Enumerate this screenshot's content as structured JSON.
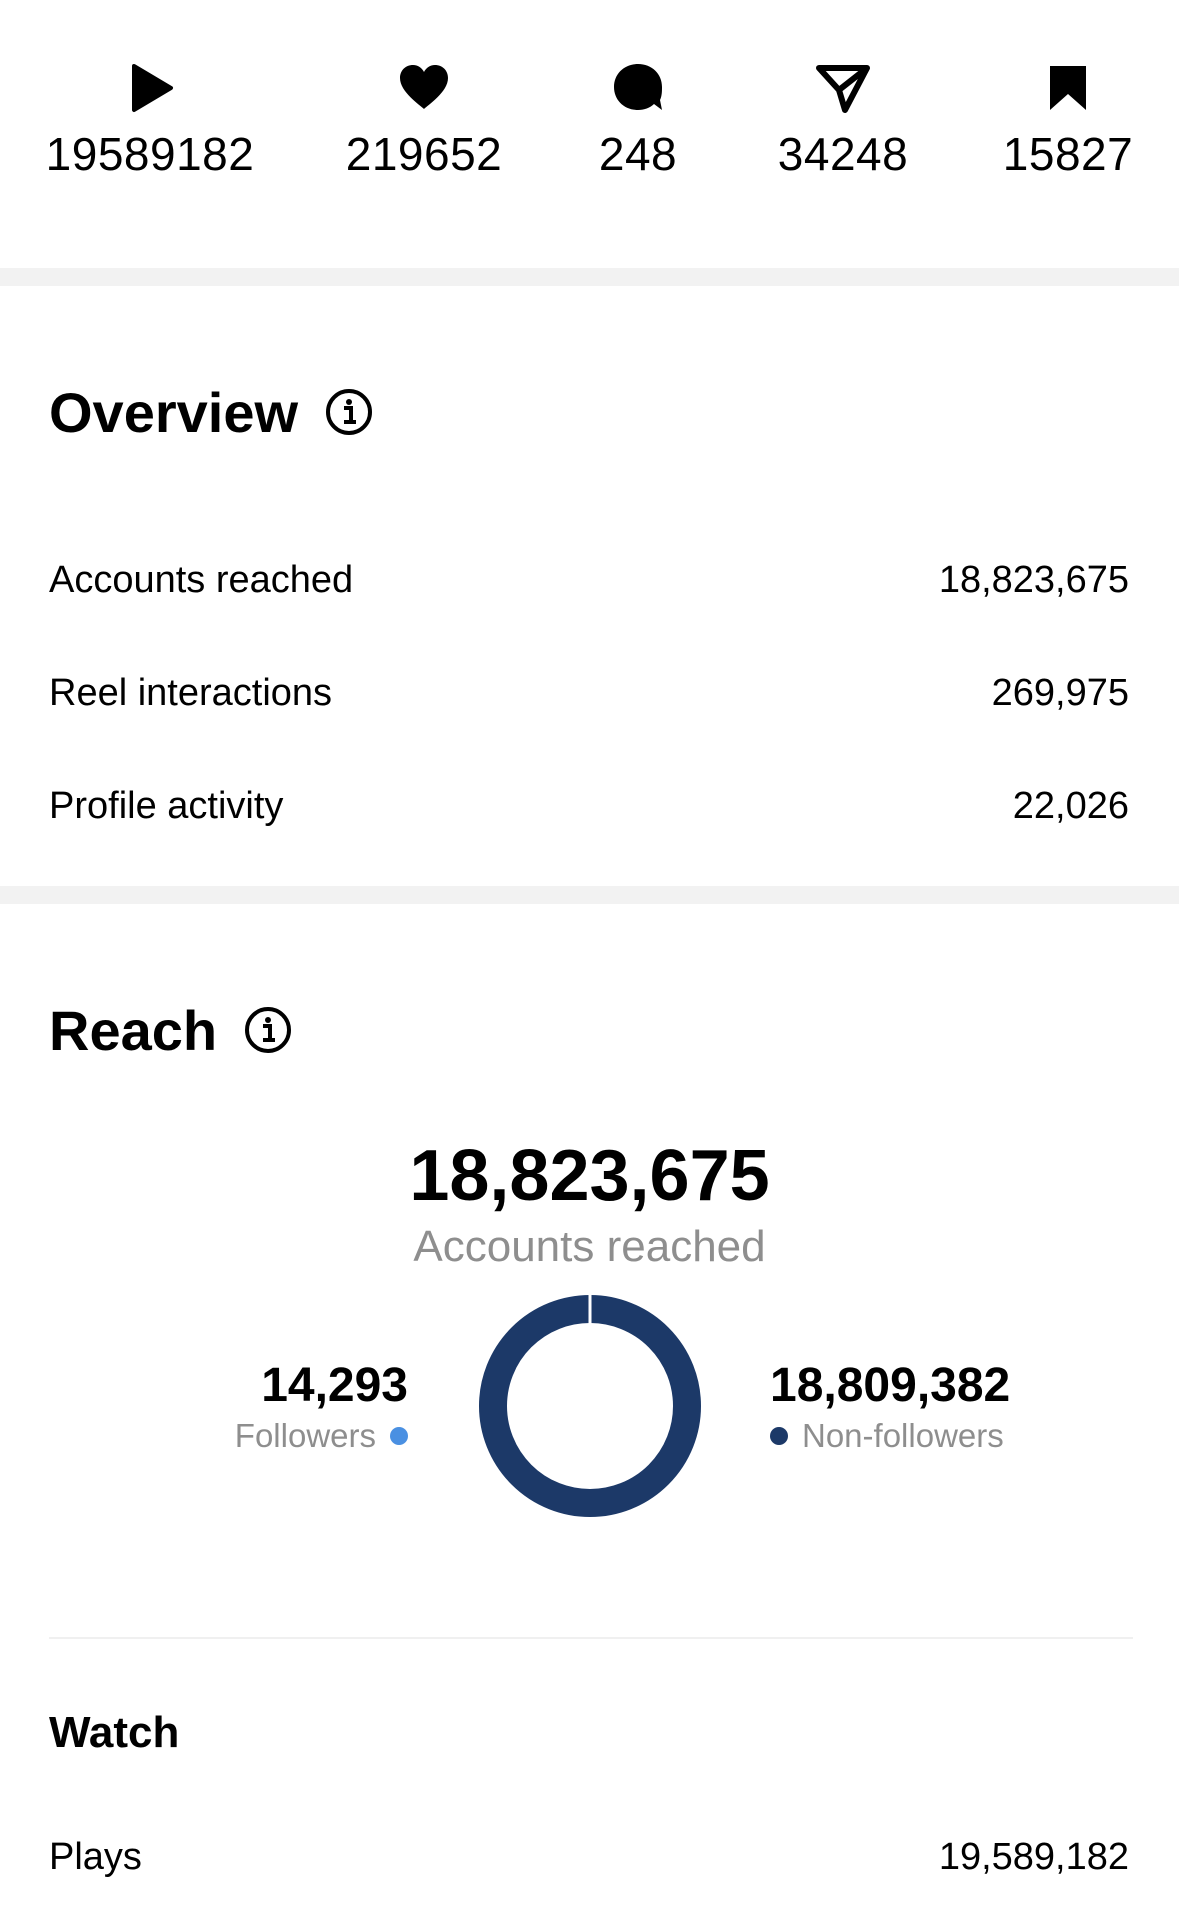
{
  "stats": [
    {
      "icon": "play-icon",
      "value": "19589182"
    },
    {
      "icon": "heart-icon",
      "value": "219652"
    },
    {
      "icon": "comment-icon",
      "value": "248"
    },
    {
      "icon": "send-icon",
      "value": "34248"
    },
    {
      "icon": "bookmark-icon",
      "value": "15827"
    }
  ],
  "overview": {
    "title": "Overview",
    "rows": [
      {
        "label": "Accounts reached",
        "value": "18,823,675"
      },
      {
        "label": "Reel interactions",
        "value": "269,975"
      },
      {
        "label": "Profile activity",
        "value": "22,026"
      }
    ]
  },
  "reach": {
    "title": "Reach",
    "total": "18,823,675",
    "caption": "Accounts reached",
    "followers": {
      "value": "14,293",
      "label": "Followers",
      "color": "#4a90e2"
    },
    "non_followers": {
      "value": "18,809,382",
      "label": "Non-followers",
      "color": "#1c3968"
    }
  },
  "watch": {
    "title": "Watch",
    "rows": [
      {
        "label": "Plays",
        "value": "19,589,182"
      }
    ]
  }
}
